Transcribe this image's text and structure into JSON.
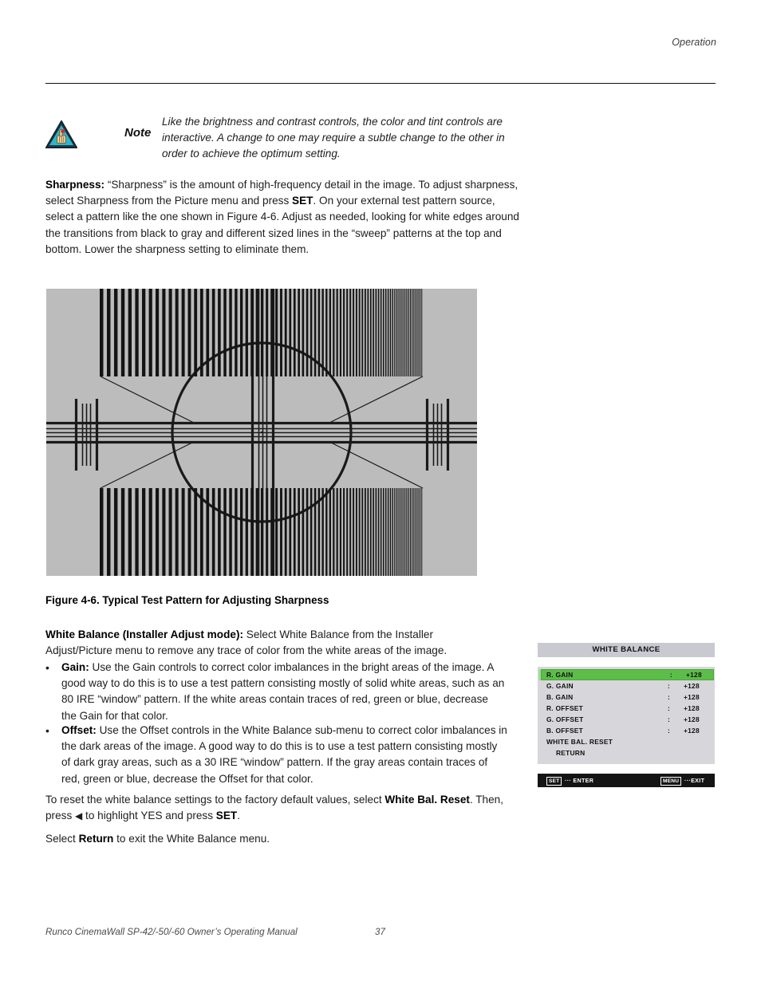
{
  "header": {
    "section_label": "Operation"
  },
  "note": {
    "icon": "note-hand-triangle-icon",
    "label": "Note",
    "text": "Like the brightness and contrast controls, the color and tint controls are interactive. A change to one may require a subtle change to the other in order to achieve the optimum setting."
  },
  "sharpness": {
    "term": "Sharpness:",
    "body_1": " “Sharpness” is the amount of high-frequency detail in the image. To adjust sharpness, select Sharpness from the Picture menu and press ",
    "key_set": "SET",
    "body_2": ". On your external test pattern source, select a pattern like the one shown in Figure 4-6. Adjust as needed, looking for white edges around the transitions from black to gray and different sized lines in the “sweep” patterns at the top and bottom. Lower the sharpness setting to eliminate them."
  },
  "figure": {
    "caption": "Figure 4-6. Typical Test Pattern for Adjusting Sharpness",
    "background_color": "#bcbcbc",
    "line_color": "#1a1a1a",
    "description": "Sharpness test pattern: horizontal frequency sweep bars at top and bottom, center circle with crosshair and multiburst line groups"
  },
  "white_balance": {
    "term": "White Balance (Installer Adjust mode):",
    "body": " Select White Balance from the Installer Adjust/Picture menu to remove any trace of color from the white areas of the image.",
    "bullets": [
      {
        "marker": "•",
        "term": "Gain:",
        "text": " Use the Gain controls to correct color imbalances in the bright areas of the image. A good way to do this is to use a test pattern consisting mostly of solid white areas, such as an 80 IRE “window” pattern. If the white areas contain traces of red, green or blue, decrease the Gain for that color."
      },
      {
        "marker": "•",
        "term": "Offset:",
        "text": " Use the Offset controls in the White Balance sub-menu to correct color imbalances in the dark areas of the image. A good way to do this is to use a test pattern consisting mostly of dark gray areas, such as a 30 IRE “window” pattern. If the gray areas contain traces of red, green or blue, decrease the Offset for that color."
      }
    ],
    "reset_1": "To reset the white balance settings to the factory default values, select ",
    "reset_bold": "White Bal. Reset",
    "reset_2": ". Then, press ",
    "reset_arrow": "◀",
    "reset_3": " to highlight YES and press ",
    "reset_key": "SET",
    "reset_4": ".",
    "return_1": "Select ",
    "return_bold": "Return",
    "return_2": " to exit the White Balance menu."
  },
  "osd": {
    "title": "WHITE BALANCE",
    "title_bg": "#c9c9d2",
    "body_bg": "#d7d7db",
    "highlight_color": "#5cbd4a",
    "rows": [
      {
        "label": "R. GAIN",
        "colon": ":",
        "value": "+128",
        "selected": true,
        "indent": false
      },
      {
        "label": "G. GAIN",
        "colon": ":",
        "value": "+128",
        "selected": false,
        "indent": false
      },
      {
        "label": "B. GAIN",
        "colon": ":",
        "value": "+128",
        "selected": false,
        "indent": false
      },
      {
        "label": "R. OFFSET",
        "colon": ":",
        "value": "+128",
        "selected": false,
        "indent": false
      },
      {
        "label": "G. OFFSET",
        "colon": ":",
        "value": "+128",
        "selected": false,
        "indent": false
      },
      {
        "label": "B. OFFSET",
        "colon": ":",
        "value": "+128",
        "selected": false,
        "indent": false
      },
      {
        "label": "WHITE BAL. RESET",
        "colon": "",
        "value": "",
        "selected": false,
        "indent": false
      },
      {
        "label": "RETURN",
        "colon": "",
        "value": "",
        "selected": false,
        "indent": true
      }
    ],
    "footer": {
      "set_key": "SET",
      "set_action": "··· ENTER",
      "menu_key": "MENU",
      "menu_action": "···EXIT",
      "background": "#141414"
    }
  },
  "footer": {
    "manual": "Runco CinemaWall SP-42/-50/-60 Owner’s Operating Manual",
    "page": "37"
  }
}
